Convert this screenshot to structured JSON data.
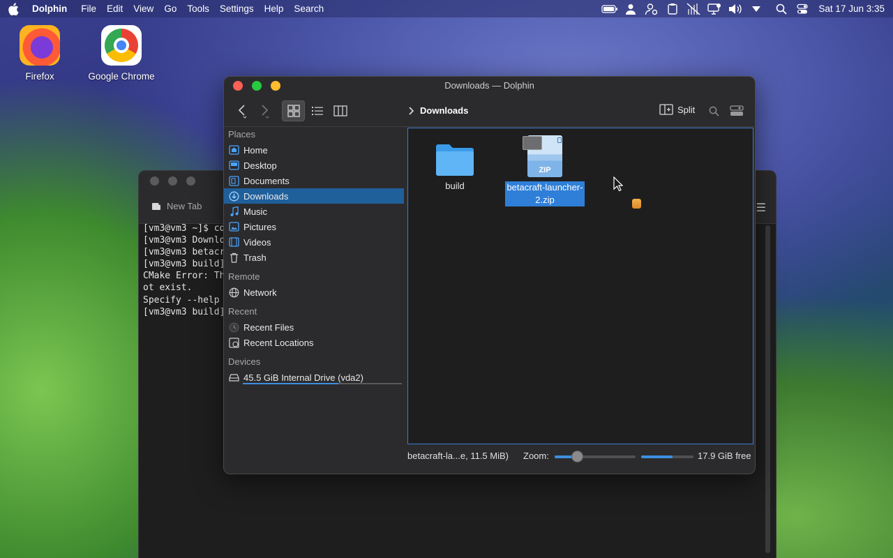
{
  "menubar": {
    "app_name": "Dolphin",
    "menus": [
      "File",
      "Edit",
      "View",
      "Go",
      "Tools",
      "Settings",
      "Help",
      "Search"
    ],
    "clock": "Sat 17 Jun 3:35",
    "tray_icons": [
      "battery-icon",
      "user-icon",
      "user-settings-icon",
      "clipboard-icon",
      "network-off-icon",
      "display-icon",
      "volume-icon",
      "chevron-down-icon",
      "search-icon",
      "control-center-icon"
    ]
  },
  "desktop": {
    "icons": [
      {
        "label": "Firefox",
        "icon": "firefox-icon"
      },
      {
        "label": "Google Chrome",
        "icon": "chrome-icon"
      }
    ]
  },
  "terminal": {
    "tab_label": "New Tab",
    "lines": [
      "[vm3@vm3 ~]$ cd",
      "[vm3@vm3 Downlo",
      "[vm3@vm3 betacr",
      "[vm3@vm3 build]",
      "CMake Error: Th",
      "ot exist.",
      "Specify --help",
      "[vm3@vm3 build]"
    ]
  },
  "dolphin": {
    "window_title": "Downloads — Dolphin",
    "breadcrumb": "Downloads",
    "split_label": "Split",
    "places": {
      "sections": [
        {
          "title": "Places",
          "items": [
            {
              "label": "Home",
              "icon": "home-icon",
              "selected": false
            },
            {
              "label": "Desktop",
              "icon": "desktop-icon",
              "selected": false
            },
            {
              "label": "Documents",
              "icon": "documents-icon",
              "selected": false
            },
            {
              "label": "Downloads",
              "icon": "downloads-icon",
              "selected": true
            },
            {
              "label": "Music",
              "icon": "music-icon",
              "selected": false
            },
            {
              "label": "Pictures",
              "icon": "pictures-icon",
              "selected": false
            },
            {
              "label": "Videos",
              "icon": "videos-icon",
              "selected": false
            },
            {
              "label": "Trash",
              "icon": "trash-icon",
              "selected": false
            }
          ]
        },
        {
          "title": "Remote",
          "items": [
            {
              "label": "Network",
              "icon": "network-icon",
              "selected": false
            }
          ]
        },
        {
          "title": "Recent",
          "items": [
            {
              "label": "Recent Files",
              "icon": "recent-files-icon",
              "selected": false
            },
            {
              "label": "Recent Locations",
              "icon": "recent-locations-icon",
              "selected": false
            }
          ]
        },
        {
          "title": "Devices",
          "items": [
            {
              "label": "45.5 GiB Internal Drive (vda2)",
              "icon": "drive-icon",
              "selected": false,
              "usage_fraction": 0.6
            }
          ]
        }
      ]
    },
    "files": [
      {
        "name": "build",
        "type": "folder",
        "selected": false
      },
      {
        "name": "betacraft-launcher-2.zip",
        "name_line1": "betacraft-launcher-",
        "name_line2": "2.zip",
        "type": "zip",
        "badge": "ZIP",
        "selected": true
      }
    ],
    "status": {
      "selection": "betacraft-la...e, 11.5 MiB)",
      "zoom_label": "Zoom:",
      "zoom_fraction": 0.28,
      "free_space": "17.9 GiB free",
      "free_fraction": 0.6
    },
    "colors": {
      "accent": "#2f7fd8",
      "close": "#fe5f57",
      "minimize": "#28c840",
      "zoom": "#febc2e"
    }
  }
}
